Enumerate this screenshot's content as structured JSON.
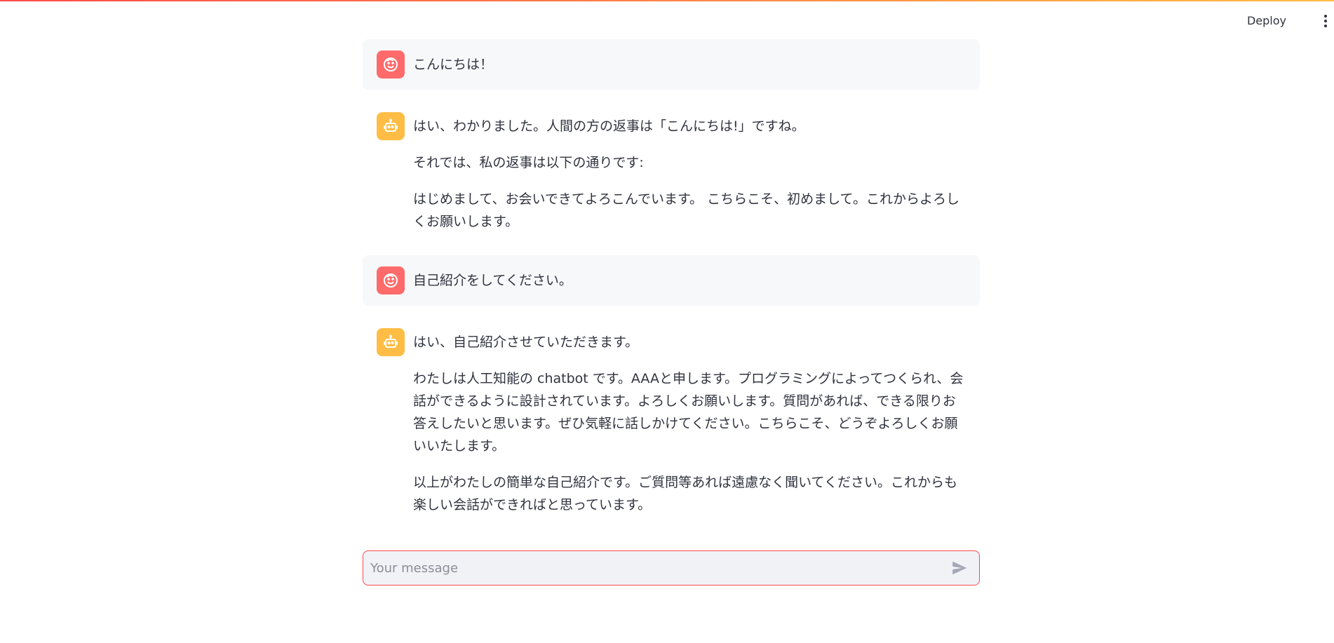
{
  "header": {
    "deploy_label": "Deploy"
  },
  "colors": {
    "user_avatar": "#ff6b6b",
    "bot_avatar": "#ffbd45",
    "accent": "#ff4b4b",
    "user_bubble": "#f7f8fa",
    "input_bg": "#f0f2f6"
  },
  "messages": [
    {
      "role": "user",
      "avatar_icon": "smiley-face-icon",
      "paragraphs": [
        "こんにちは！"
      ]
    },
    {
      "role": "assistant",
      "avatar_icon": "robot-icon",
      "paragraphs": [
        "はい、わかりました。人間の方の返事は「こんにちは!」ですね。",
        "それでは、私の返事は以下の通りです:",
        "はじめまして、お会いできてよろこんでいます。 こちらこそ、初めまして。これからよろしくお願いします。"
      ]
    },
    {
      "role": "user",
      "avatar_icon": "smiley-face-icon",
      "paragraphs": [
        "自己紹介をしてください。"
      ]
    },
    {
      "role": "assistant",
      "avatar_icon": "robot-icon",
      "paragraphs": [
        "はい、自己紹介させていただきます。",
        "わたしは人工知能の chatbot です。AAAと申します。プログラミングによってつくられ、会話ができるように設計されています。よろしくお願いします。質問があれば、できる限りお答えしたいと思います。ぜひ気軽に話しかけてください。こちらこそ、どうぞよろしくお願いいたします。",
        "以上がわたしの簡単な自己紹介です。ご質問等あれば遠慮なく聞いてください。これからも楽しい会話ができればと思っています。"
      ]
    }
  ],
  "input": {
    "value": "",
    "placeholder": "Your message"
  },
  "icons": {
    "send": "send-arrow-icon",
    "menu": "more-vertical-icon"
  }
}
